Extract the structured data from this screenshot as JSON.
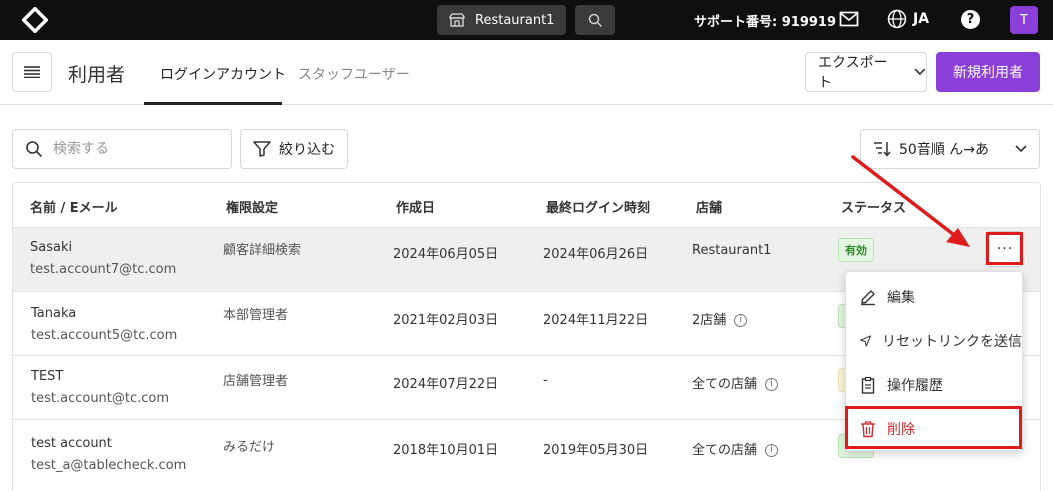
{
  "topbar": {
    "venue": "Restaurant1",
    "support": "サポート番号: 919919",
    "lang": "JA",
    "help": "?",
    "avatar": "T"
  },
  "header": {
    "title": "利用者",
    "tabs": [
      {
        "label": "ログインアカウント",
        "active": true
      },
      {
        "label": "スタッフユーザー",
        "active": false
      }
    ],
    "export_label": "エクスポート",
    "new_user_label": "新規利用者"
  },
  "filters": {
    "search_placeholder": "検索する",
    "filter_label": "絞り込む",
    "sort_label": "50音順 ん→あ"
  },
  "table": {
    "columns": [
      "名前 / Eメール",
      "権限設定",
      "作成日",
      "最終ログイン時刻",
      "店舗",
      "ステータス"
    ],
    "rows": [
      {
        "name": "Sasaki",
        "email": "test.account7@tc.com",
        "role": "顧客詳細検索",
        "created": "2024年06月05日",
        "last_login": "2024年06月26日",
        "store": "Restaurant1",
        "store_info": false,
        "status": "有効"
      },
      {
        "name": "Tanaka",
        "email": "test.account5@tc.com",
        "role": "本部管理者",
        "created": "2021年02月03日",
        "last_login": "2024年11月22日",
        "store": "2店舗",
        "store_info": true,
        "status": ""
      },
      {
        "name": "TEST",
        "email": "test.account@tc.com",
        "role": "店舗管理者",
        "created": "2024年07月22日",
        "last_login": "-",
        "store": "全ての店舗",
        "store_info": true,
        "status": ""
      },
      {
        "name": "test account",
        "email": "test_a@tablecheck.com",
        "role": "みるだけ",
        "created": "2018年10月01日",
        "last_login": "2019年05月30日",
        "store": "全ての店舗",
        "store_info": true,
        "status": ""
      }
    ],
    "more_label": "···"
  },
  "menu": {
    "items": [
      {
        "label": "編集",
        "icon": "pencil-icon"
      },
      {
        "label": "リセットリンクを送信",
        "icon": "send-icon"
      },
      {
        "label": "操作履歴",
        "icon": "clipboard-icon"
      },
      {
        "label": "削除",
        "icon": "trash-icon"
      }
    ]
  },
  "colors": {
    "accent": "#8b3fd9",
    "annotation": "#e01b1b",
    "status_active": "#2e8a2a"
  }
}
